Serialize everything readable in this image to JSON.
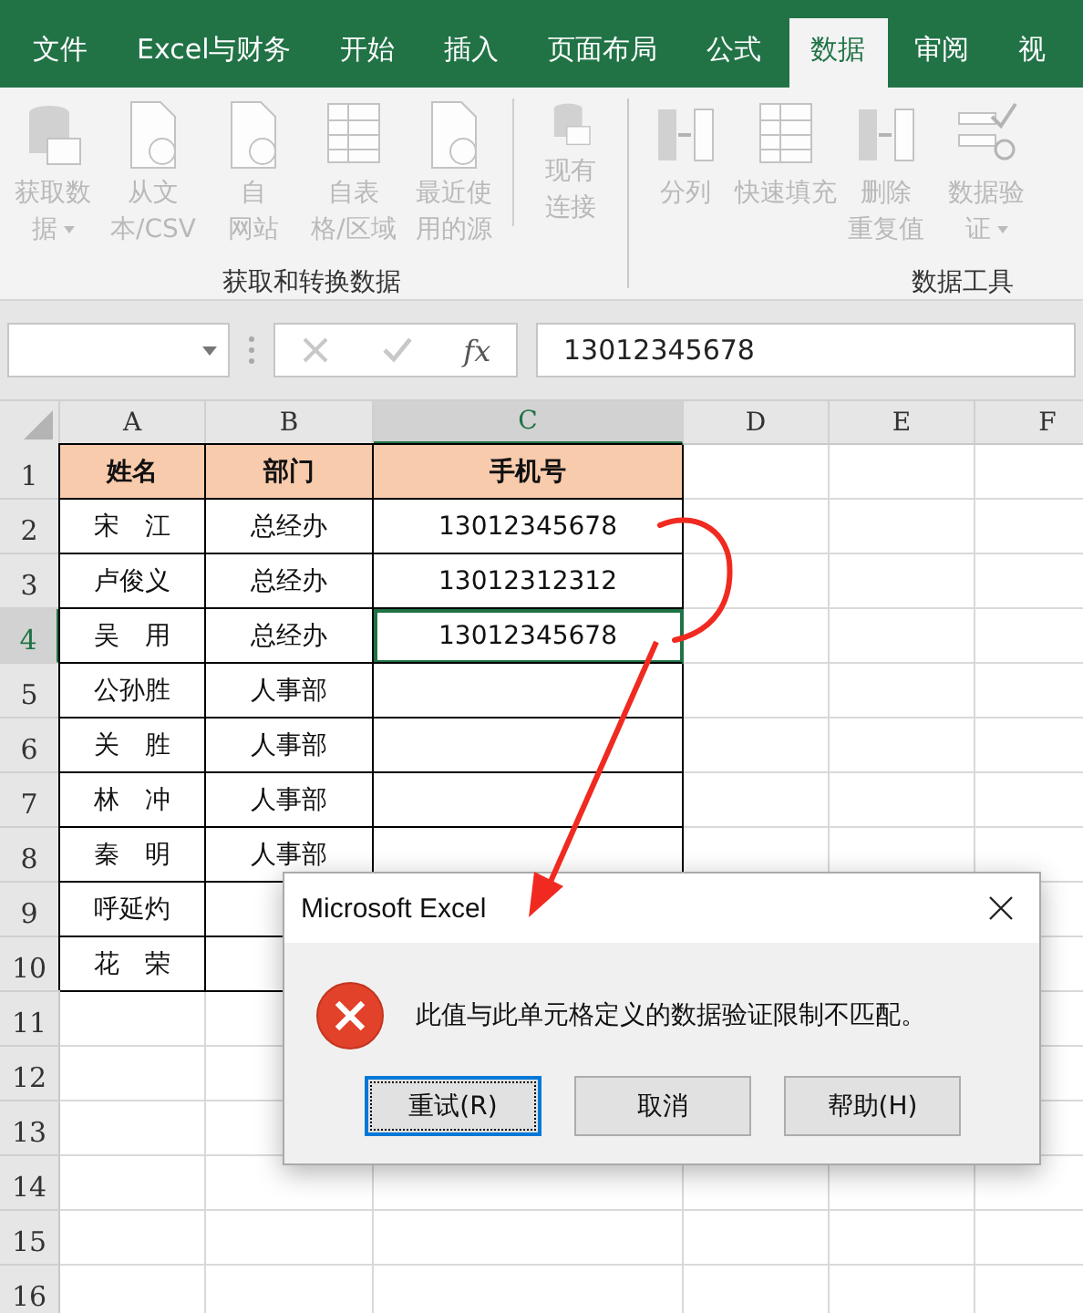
{
  "tabs": [
    {
      "label": "文件",
      "selected": false
    },
    {
      "label": "Excel与财务",
      "selected": false
    },
    {
      "label": "开始",
      "selected": false
    },
    {
      "label": "插入",
      "selected": false
    },
    {
      "label": "页面布局",
      "selected": false
    },
    {
      "label": "公式",
      "selected": false
    },
    {
      "label": "数据",
      "selected": true
    },
    {
      "label": "审阅",
      "selected": false
    },
    {
      "label": "视",
      "selected": false
    }
  ],
  "ribbon_groups": [
    {
      "label": "获取和转换数据",
      "buttons": [
        {
          "lines": [
            "获取数",
            "据"
          ],
          "dropdown": true,
          "disabled": true
        },
        {
          "lines": [
            "从文",
            "本/CSV"
          ],
          "dropdown": false,
          "disabled": true
        },
        {
          "lines": [
            "自",
            "网站"
          ],
          "dropdown": false,
          "disabled": true
        },
        {
          "lines": [
            "自表",
            "格/区域"
          ],
          "dropdown": false,
          "disabled": true
        },
        {
          "lines": [
            "最近使",
            "用的源"
          ],
          "dropdown": false,
          "disabled": true
        },
        {
          "lines": [
            "现有",
            "连接"
          ],
          "dropdown": false,
          "disabled": true,
          "separated": true
        }
      ]
    },
    {
      "label": "数据工具",
      "buttons": [
        {
          "lines": [
            "分列"
          ],
          "dropdown": false,
          "disabled": true
        },
        {
          "lines": [
            "快速填充"
          ],
          "dropdown": false,
          "disabled": true
        },
        {
          "lines": [
            "删除",
            "重复值"
          ],
          "dropdown": false,
          "disabled": true
        },
        {
          "lines": [
            "数据验",
            "证"
          ],
          "dropdown": true,
          "disabled": true
        }
      ]
    }
  ],
  "formula_bar": {
    "fx": "fx",
    "value": "13012345678"
  },
  "columns": [
    {
      "label": "A",
      "selected": false
    },
    {
      "label": "B",
      "selected": false
    },
    {
      "label": "C",
      "selected": true
    },
    {
      "label": "D",
      "selected": false
    },
    {
      "label": "E",
      "selected": false
    },
    {
      "label": "F",
      "selected": false
    }
  ],
  "rows": [
    {
      "header": "1",
      "selected": false,
      "kind": "heading",
      "cells": [
        "姓名",
        "部门",
        "手机号"
      ]
    },
    {
      "header": "2",
      "selected": false,
      "kind": "data",
      "cells": [
        "宋　江",
        "总经办",
        "13012345678"
      ]
    },
    {
      "header": "3",
      "selected": false,
      "kind": "data",
      "cells": [
        "卢俊义",
        "总经办",
        "13012312312"
      ]
    },
    {
      "header": "4",
      "selected": true,
      "kind": "data",
      "cells": [
        "吴　用",
        "总经办",
        "13012345678"
      ]
    },
    {
      "header": "5",
      "selected": false,
      "kind": "data",
      "cells": [
        "公孙胜",
        "人事部"
      ]
    },
    {
      "header": "6",
      "selected": false,
      "kind": "data",
      "cells": [
        "关　胜",
        "人事部"
      ]
    },
    {
      "header": "7",
      "selected": false,
      "kind": "data",
      "cells": [
        "林　冲",
        "人事部"
      ]
    },
    {
      "header": "8",
      "selected": false,
      "kind": "data",
      "cells": [
        "秦　明",
        "人事部"
      ]
    },
    {
      "header": "9",
      "selected": false,
      "kind": "data",
      "cells": [
        "呼延灼"
      ]
    },
    {
      "header": "10",
      "selected": false,
      "kind": "data",
      "cells": [
        "花　荣"
      ]
    },
    {
      "header": "11",
      "selected": false,
      "kind": "empty"
    },
    {
      "header": "12",
      "selected": false,
      "kind": "empty"
    },
    {
      "header": "13",
      "selected": false,
      "kind": "empty"
    },
    {
      "header": "14",
      "selected": false,
      "kind": "empty"
    },
    {
      "header": "15",
      "selected": false,
      "kind": "empty"
    },
    {
      "header": "16",
      "selected": false,
      "kind": "empty"
    }
  ],
  "dialog": {
    "title": "Microsoft Excel",
    "message": "此值与此单元格定义的数据验证限制不匹配。",
    "buttons": [
      {
        "label": "重试(R)",
        "selected": true
      },
      {
        "label": "取消",
        "selected": false
      },
      {
        "label": "帮助(H)",
        "selected": false
      }
    ]
  }
}
